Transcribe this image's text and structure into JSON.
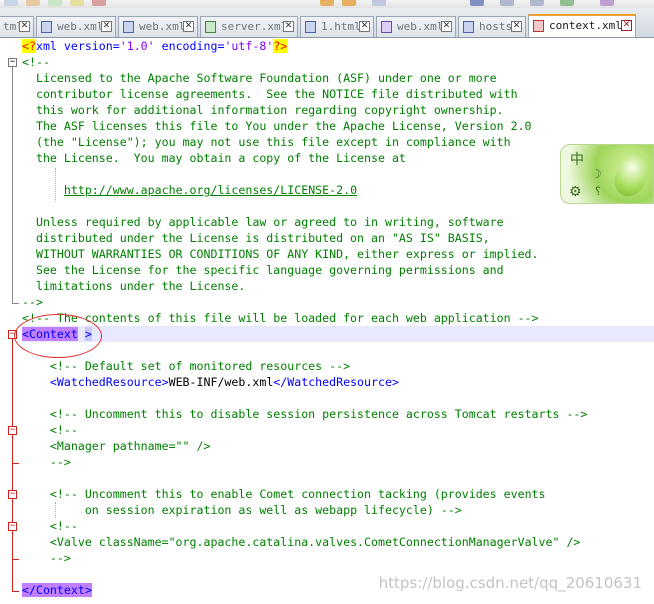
{
  "tabs": [
    {
      "label": "tml",
      "icon": "file-icon"
    },
    {
      "label": "web.xml",
      "icon": "file-icon"
    },
    {
      "label": "web.xml",
      "icon": "file-icon"
    },
    {
      "label": "server.xml",
      "icon": "file-icon"
    },
    {
      "label": "1.html",
      "icon": "file-icon"
    },
    {
      "label": "web.xml",
      "icon": "file-icon"
    },
    {
      "label": "hosts",
      "icon": "file-icon"
    },
    {
      "label": "context.xml",
      "icon": "file-icon",
      "active": true
    }
  ],
  "code": {
    "pi_open": "<?",
    "pi_name": "xml version=",
    "pi_version": "'1.0'",
    "pi_enc_attr": " encoding=",
    "pi_enc": "'utf-8'",
    "pi_close": "?>",
    "c1_open": "<!--",
    "license": [
      "  Licensed to the Apache Software Foundation (ASF) under one or more",
      "  contributor license agreements.  See the NOTICE file distributed with",
      "  this work for additional information regarding copyright ownership.",
      "  The ASF licenses this file to You under the Apache License, Version 2.0",
      "  (the \"License\"); you may not use this file except in compliance with",
      "  the License.  You may obtain a copy of the License at"
    ],
    "license_url": "http://www.apache.org/licenses/LICENSE-2.0",
    "license2": [
      "  Unless required by applicable law or agreed to in writing, software",
      "  distributed under the License is distributed on an \"AS IS\" BASIS,",
      "  WITHOUT WARRANTIES OR CONDITIONS OF ANY KIND, either express or implied.",
      "  See the License for the specific language governing permissions and",
      "  limitations under the License."
    ],
    "c1_close": "-->",
    "c2": "<!-- The contents of this file will be loaded for each web application -->",
    "context_open": "<Context",
    "context_close_bracket": ">",
    "c3": "<!-- Default set of monitored resources -->",
    "wr_open": "<WatchedResource>",
    "wr_text": "WEB-INF/web.xml",
    "wr_close": "</WatchedResource>",
    "c4": "<!-- Uncomment this to disable session persistence across Tomcat restarts -->",
    "c5_open": "<!--",
    "manager": "<Manager pathname=\"\" />",
    "c5_close": "-->",
    "c6a": "<!-- Uncomment this to enable Comet connection tacking (provides events",
    "c6b": "     on session expiration as well as webapp lifecycle) -->",
    "c7_open": "<!--",
    "valve": "<Valve className=\"org.apache.catalina.valves.CometConnectionManagerValve\" />",
    "c7_close": "-->",
    "context_end": "</Context>"
  },
  "ime": {
    "lang": "中",
    "moon": "☽",
    "gear": "⚙",
    "help": "؟"
  },
  "watermark": "https://blog.csdn.net/qq_20610631",
  "colors": {
    "tag": "#0000ff",
    "comment": "#008000",
    "pi": "#ff0000",
    "string": "#8000ff",
    "fold_red": "#d02020"
  }
}
